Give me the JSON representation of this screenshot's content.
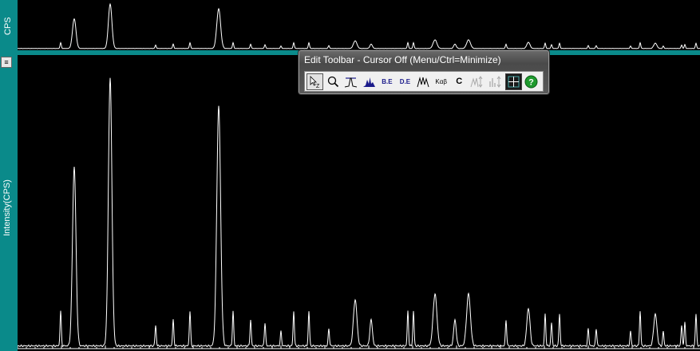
{
  "axes": {
    "top_label": "CPS",
    "main_label": "Intensity(CPS)"
  },
  "expand_glyph": "≡",
  "colors": {
    "background": "#000000",
    "frame": "#0a8a8a",
    "trace": "#ffffff"
  },
  "toolbar": {
    "title": "Edit Toolbar - Cursor Off (Menu/Ctrl=Minimize)",
    "buttons": [
      {
        "name": "cursor-zoom-icon",
        "active": true
      },
      {
        "name": "magnifier-icon"
      },
      {
        "name": "peak-marker-icon"
      },
      {
        "name": "filled-peak-icon"
      },
      {
        "name": "be-icon",
        "text": "B.E"
      },
      {
        "name": "de-icon",
        "text": "D.E"
      },
      {
        "name": "multi-peak-icon"
      },
      {
        "name": "kab-icon",
        "text": "Kαβ"
      },
      {
        "name": "c-icon",
        "text": "C"
      },
      {
        "name": "peak-arrow-icon",
        "disabled": true
      },
      {
        "name": "bars-arrow-icon",
        "disabled": true
      },
      {
        "name": "grid-icon"
      },
      {
        "name": "help-icon",
        "text": "?"
      }
    ]
  }
}
